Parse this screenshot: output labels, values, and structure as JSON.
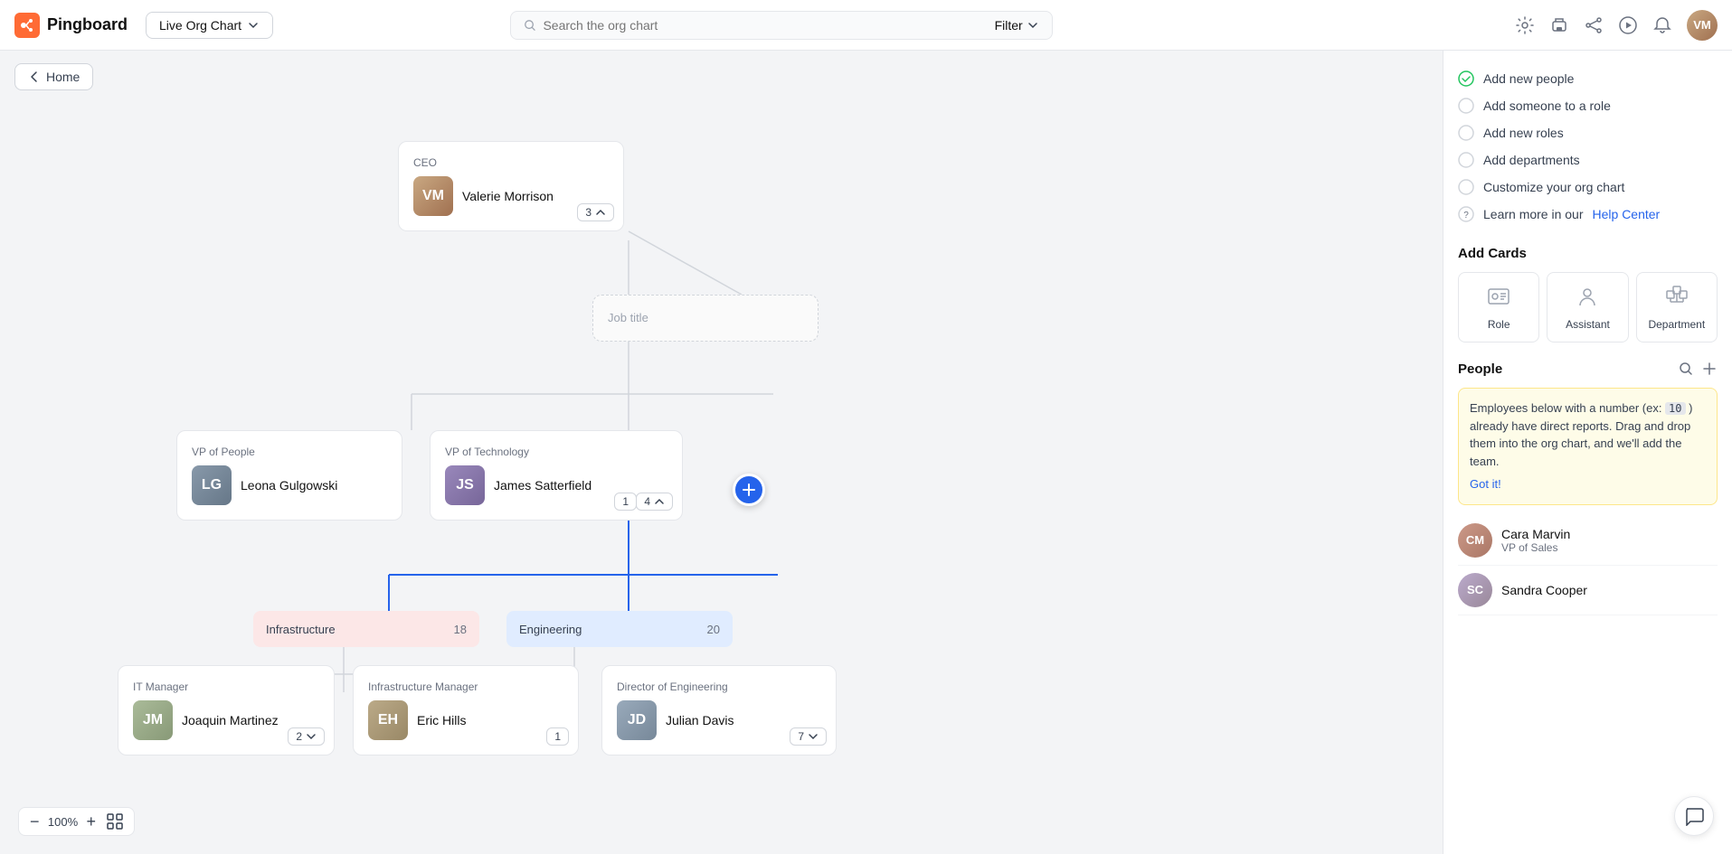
{
  "header": {
    "logo_text": "Pingboard",
    "chart_selector_label": "Live Org Chart",
    "search_placeholder": "Search the org chart",
    "filter_label": "Filter"
  },
  "nav": {
    "home_label": "Home"
  },
  "org": {
    "ceo": {
      "title": "CEO",
      "name": "Valerie Morrison",
      "reports": "3",
      "initials": "VM"
    },
    "job_title_placeholder": "Job title",
    "vp_people": {
      "title": "VP of People",
      "name": "Leona Gulgowski",
      "initials": "LG"
    },
    "vp_tech": {
      "title": "VP of Technology",
      "name": "James Satterfield",
      "direct_reports": "1",
      "reports": "4",
      "initials": "JS"
    },
    "infra_dept": {
      "label": "Infrastructure",
      "count": "18"
    },
    "eng_dept": {
      "label": "Engineering",
      "count": "20"
    },
    "it_manager": {
      "title": "IT Manager",
      "name": "Joaquin Martinez",
      "reports": "2",
      "initials": "JM"
    },
    "infra_manager": {
      "title": "Infrastructure Manager",
      "name": "Eric Hills",
      "reports": "1",
      "initials": "EH"
    },
    "dir_engineering": {
      "title": "Director of Engineering",
      "name": "Julian Davis",
      "reports": "7",
      "initials": "JD"
    }
  },
  "zoom": {
    "level": "100%",
    "minus": "−",
    "plus": "+"
  },
  "right_panel": {
    "quick_links": [
      {
        "icon": "✓",
        "label": "Add new people"
      },
      {
        "icon": "○",
        "label": "Add someone to a role"
      },
      {
        "icon": "○",
        "label": "Add new roles"
      },
      {
        "icon": "○",
        "label": "Add departments"
      },
      {
        "icon": "○",
        "label": "Customize your org chart"
      },
      {
        "icon": "?",
        "label": "Learn more in our",
        "link": "Help Center"
      }
    ],
    "add_cards_title": "Add Cards",
    "add_card_types": [
      {
        "icon": "⊞",
        "label": "Role"
      },
      {
        "icon": "⊟",
        "label": "Assistant"
      },
      {
        "icon": "⊠",
        "label": "Department"
      }
    ],
    "people_title": "People",
    "info_banner": "Employees below with a number (ex: 10 ) already have direct reports. Drag and drop them into the org chart, and we'll add the team.",
    "info_banner_num": "10",
    "got_it_label": "Got it!",
    "people": [
      {
        "name": "Cara Marvin",
        "role": "VP of Sales",
        "initials": "CM"
      },
      {
        "name": "Sandra Cooper",
        "role": "",
        "initials": "SC"
      }
    ]
  }
}
